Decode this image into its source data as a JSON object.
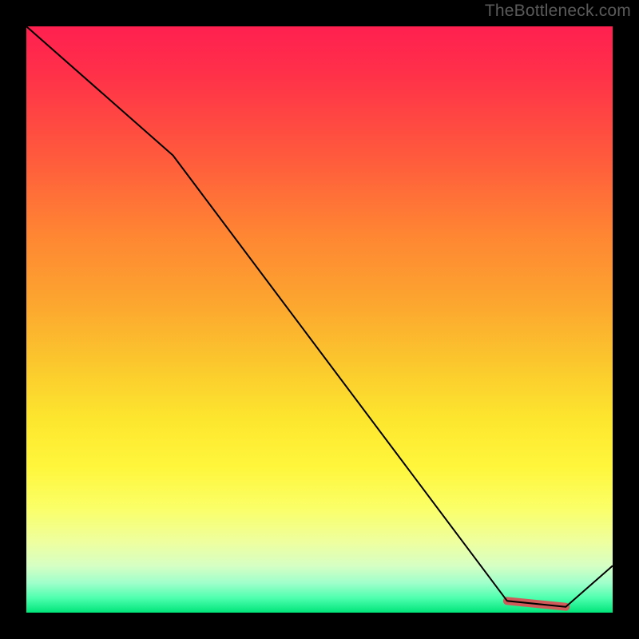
{
  "watermark": "TheBottleneck.com",
  "chart_data": {
    "type": "line",
    "title": "",
    "xlabel": "",
    "ylabel": "",
    "xlim": [
      0,
      100
    ],
    "ylim": [
      0,
      100
    ],
    "grid": false,
    "series": [
      {
        "name": "bottleneck-curve",
        "x": [
          0,
          25,
          82,
          92,
          100
        ],
        "y": [
          100,
          78,
          2,
          1,
          8
        ]
      }
    ],
    "highlight_segment": {
      "name": "optimal-range",
      "x": [
        82,
        92
      ],
      "y": [
        2,
        1
      ]
    },
    "background_gradient": {
      "top_color": "#ff2050",
      "mid_color": "#ffe030",
      "bottom_color": "#00e57a"
    }
  },
  "colors": {
    "page_bg": "#000000",
    "watermark": "#5a5a5a",
    "line": "#000000",
    "highlight": "#d05a5a"
  }
}
